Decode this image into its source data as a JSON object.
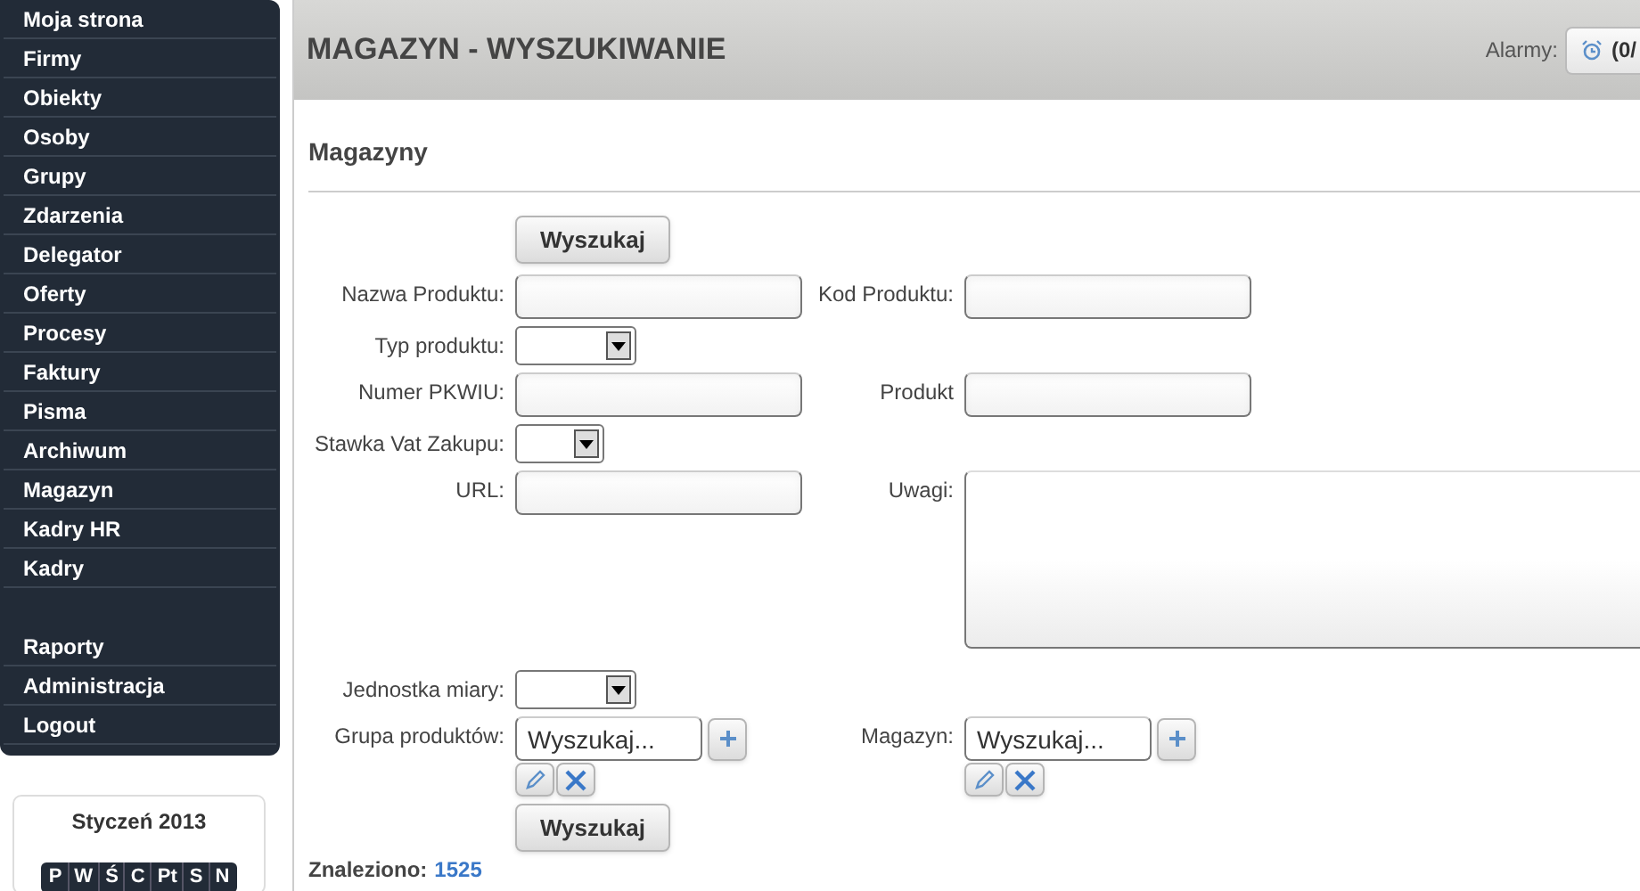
{
  "sidebar": {
    "groups": [
      [
        {
          "label": "Moja strona"
        },
        {
          "label": "Firmy"
        },
        {
          "label": "Obiekty"
        },
        {
          "label": "Osoby"
        },
        {
          "label": "Grupy"
        },
        {
          "label": "Zdarzenia"
        },
        {
          "label": "Delegator"
        },
        {
          "label": "Oferty"
        },
        {
          "label": "Procesy"
        },
        {
          "label": "Faktury"
        },
        {
          "label": "Pisma"
        },
        {
          "label": "Archiwum"
        },
        {
          "label": "Magazyn"
        },
        {
          "label": "Kadry HR"
        },
        {
          "label": "Kadry"
        }
      ],
      [
        {
          "label": "Raporty"
        },
        {
          "label": "Administracja"
        },
        {
          "label": "Logout"
        }
      ]
    ]
  },
  "calendar": {
    "title": "Styczeń 2013",
    "weekdays": [
      "P",
      "W",
      "Ś",
      "C",
      "Pt",
      "S",
      "N"
    ]
  },
  "header": {
    "title": "MAGAZYN - WYSZUKIWANIE",
    "alarms_label": "Alarmy:",
    "alarm_button": "(0/"
  },
  "section": {
    "title": "Magazyny"
  },
  "search_button_top": "Wyszukaj",
  "form": {
    "rows": [
      {
        "left": {
          "label": "Nazwa Produktu:",
          "kind": "text"
        },
        "right": {
          "label": "Kod Produktu:",
          "kind": "text"
        }
      },
      {
        "left": {
          "label": "Typ produktu:",
          "kind": "select"
        }
      },
      {
        "left": {
          "label": "Numer PKWIU:",
          "kind": "text"
        },
        "right": {
          "label": "Produkt",
          "kind": "text"
        }
      },
      {
        "left": {
          "label": "Stawka Vat Zakupu:",
          "kind": "select_small"
        }
      },
      {
        "left": {
          "label": "URL:",
          "kind": "text"
        },
        "right": {
          "label": "Uwagi:",
          "kind": "textarea"
        }
      },
      {
        "left": {
          "label": "Jednostka miary:",
          "kind": "select"
        }
      },
      {
        "left": {
          "label": "Grupa produktów:",
          "kind": "lookup",
          "placeholder": "Wyszukaj..."
        },
        "right": {
          "label": "Magazyn:",
          "kind": "lookup",
          "placeholder": "Wyszukaj..."
        }
      }
    ]
  },
  "search_button_bottom": "Wyszukaj",
  "found": {
    "label": "Znaleziono:",
    "count": "1525"
  }
}
